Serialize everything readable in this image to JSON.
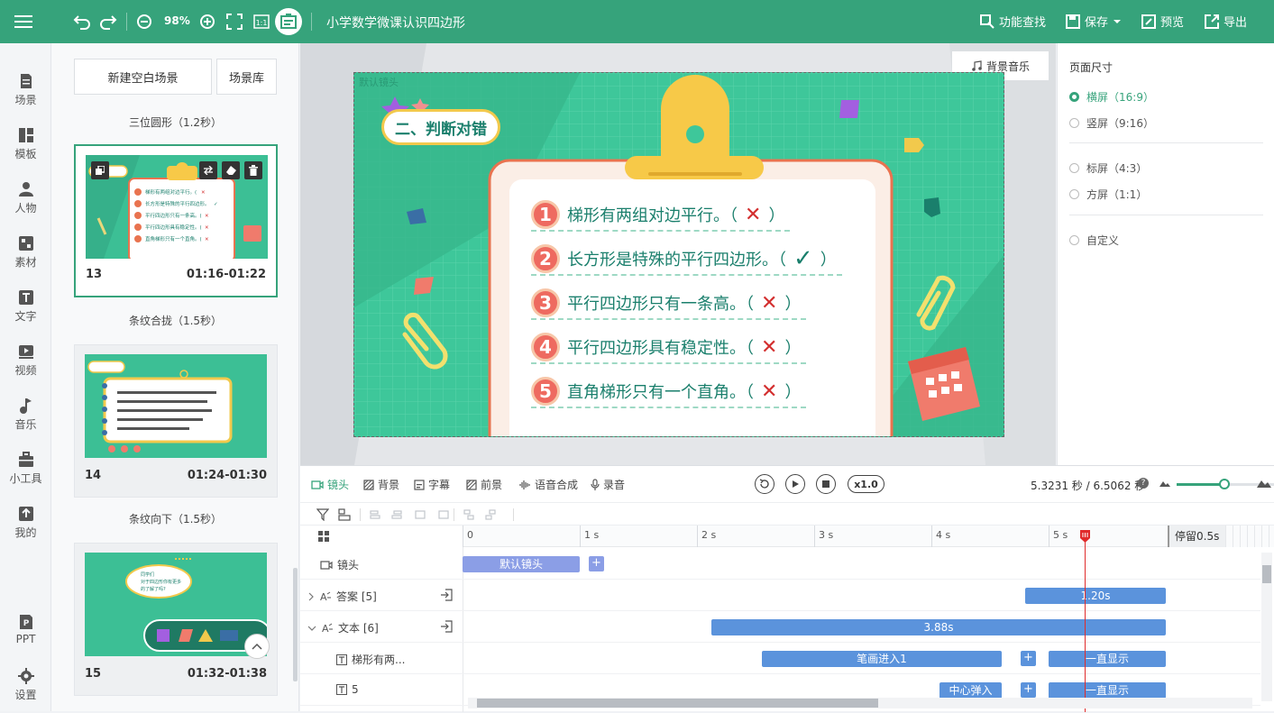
{
  "topbar": {
    "zoom": "98%",
    "project_title": "小学数学微课认识四边形",
    "find_feature": "功能查找",
    "save": "保存",
    "preview": "预览",
    "export": "导出"
  },
  "left_nav": {
    "items": [
      {
        "label": "场景"
      },
      {
        "label": "模板"
      },
      {
        "label": "人物"
      },
      {
        "label": "素材"
      },
      {
        "label": "文字"
      },
      {
        "label": "视频"
      },
      {
        "label": "音乐"
      },
      {
        "label": "小工具"
      },
      {
        "label": "我的"
      },
      {
        "label": "PPT"
      },
      {
        "label": "设置"
      }
    ]
  },
  "scene_panel": {
    "new_blank": "新建空白场景",
    "library": "场景库",
    "scenes": [
      {
        "transition": "三位圆形（1.2秒）",
        "number": "13",
        "time": "01:16-01:22"
      },
      {
        "transition": "条纹合拢（1.5秒）",
        "number": "14",
        "time": "01:24-01:30"
      },
      {
        "transition": "条纹向下（1.5秒）",
        "number": "15",
        "time": "01:32-01:38"
      }
    ]
  },
  "stage": {
    "bg_music": "背景音乐",
    "lens_label": "默认镜头",
    "section_title": "二、判断对错",
    "items": [
      {
        "num": "1",
        "text": "梯形有两组对边平行。（",
        "mark": "✕",
        "close": "）"
      },
      {
        "num": "2",
        "text": "长方形是特殊的平行四边形。（",
        "mark": "✓",
        "close": "）"
      },
      {
        "num": "3",
        "text": "平行四边形只有一条高。（",
        "mark": "✕",
        "close": "）"
      },
      {
        "num": "4",
        "text": "平行四边形具有稳定性。（",
        "mark": "✕",
        "close": "）"
      },
      {
        "num": "5",
        "text": "直角梯形只有一个直角。（",
        "mark": "✕",
        "close": "）"
      }
    ]
  },
  "right_panel": {
    "title": "页面尺寸",
    "options": [
      "横屏（16:9）",
      "竖屏（9:16）",
      "标屏（4:3）",
      "方屏（1:1）",
      "自定义"
    ]
  },
  "timeline": {
    "tabs": [
      "镜头",
      "背景",
      "字幕",
      "前景",
      "语音合成",
      "录音"
    ],
    "speed": "x1.0",
    "time_display": "5.3231 秒 / 6.5062 秒",
    "ticks": [
      "0",
      "1 s",
      "2 s",
      "3 s",
      "4 s",
      "5 s"
    ],
    "pause": "停留0.5s",
    "rows": [
      {
        "label": "镜头",
        "bar": "默认镜头"
      },
      {
        "label": "答案 [5]",
        "bar": "1.20s"
      },
      {
        "label": "文本 [6]",
        "bar": "3.88s"
      },
      {
        "label": "梯形有两...",
        "bar": "笔画进入1",
        "bar2": "一直显示"
      },
      {
        "label": "5",
        "bar": "中心弹入",
        "bar2": "一直显示"
      }
    ]
  },
  "colors": {
    "brand": "#36a37b",
    "bar": "#5b93dc",
    "lens_bar": "#8b9ee6",
    "playhead": "#e02b2b"
  }
}
